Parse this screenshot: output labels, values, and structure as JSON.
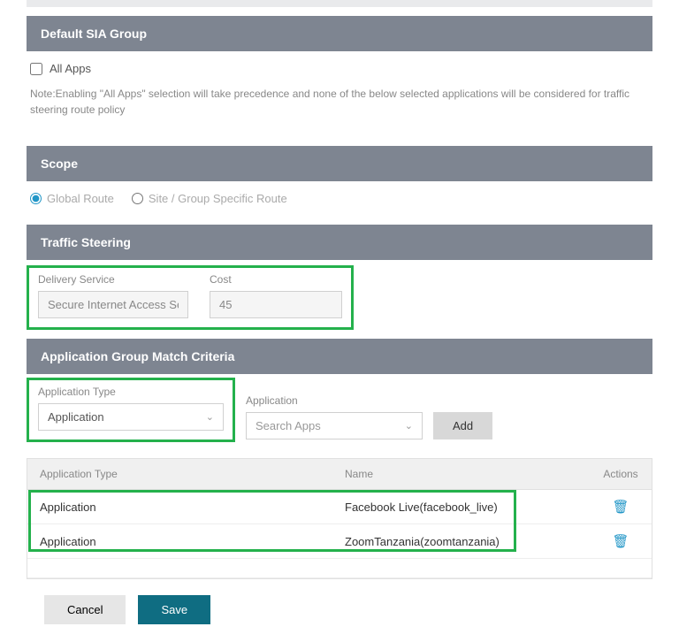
{
  "defaultSiaGroup": {
    "header": "Default SIA Group",
    "allAppsLabel": "All Apps",
    "note": "Note:Enabling \"All Apps\" selection will take precedence and none of the below selected applications will be considered for traffic steering route policy"
  },
  "scope": {
    "header": "Scope",
    "globalRouteLabel": "Global Route",
    "siteGroupRouteLabel": "Site / Group Specific Route"
  },
  "trafficSteering": {
    "header": "Traffic Steering",
    "deliveryServiceLabel": "Delivery Service",
    "deliveryServiceValue": "Secure Internet Access Serv",
    "costLabel": "Cost",
    "costValue": "45"
  },
  "matchCriteria": {
    "header": "Application Group Match Criteria",
    "appTypeLabel": "Application Type",
    "appTypeValue": "Application",
    "applicationLabel": "Application",
    "searchPlaceholder": "Search Apps",
    "addLabel": "Add",
    "table": {
      "colAppType": "Application Type",
      "colName": "Name",
      "colActions": "Actions",
      "rows": [
        {
          "appType": "Application",
          "name": "Facebook Live(facebook_live)"
        },
        {
          "appType": "Application",
          "name": "ZoomTanzania(zoomtanzania)"
        }
      ]
    }
  },
  "buttons": {
    "cancel": "Cancel",
    "save": "Save"
  }
}
